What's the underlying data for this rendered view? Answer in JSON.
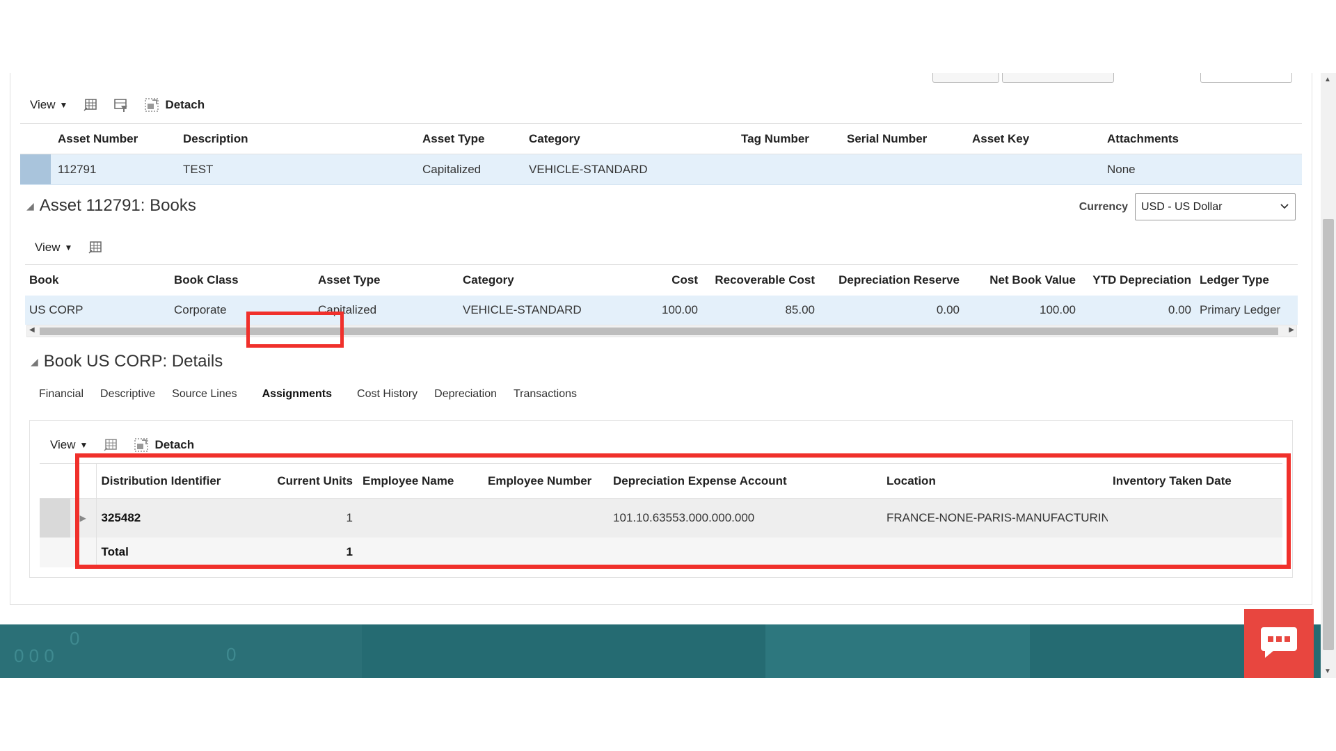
{
  "toolbar1": {
    "view_label": "View",
    "detach_label": "Detach"
  },
  "asset_table": {
    "headers": [
      "Asset Number",
      "Description",
      "Asset Type",
      "Category",
      "Tag Number",
      "Serial Number",
      "Asset Key",
      "Attachments"
    ],
    "row": {
      "asset_number": "112791",
      "description": "TEST",
      "asset_type": "Capitalized",
      "category": "VEHICLE-STANDARD",
      "tag_number": "",
      "serial_number": "",
      "asset_key": "",
      "attachments": "None"
    }
  },
  "books_section": {
    "title": "Asset 112791: Books",
    "currency_label": "Currency",
    "currency_value": "USD - US Dollar",
    "view_label": "View"
  },
  "books_table": {
    "headers": [
      "Book",
      "Book Class",
      "Asset Type",
      "Category",
      "Cost",
      "Recoverable Cost",
      "Depreciation Reserve",
      "Net Book Value",
      "YTD Depreciation",
      "Ledger Type"
    ],
    "row": {
      "book": "US CORP",
      "book_class": "Corporate",
      "asset_type": "Capitalized",
      "category": "VEHICLE-STANDARD",
      "cost": "100.00",
      "recoverable_cost": "85.00",
      "depreciation_reserve": "0.00",
      "net_book_value": "100.00",
      "ytd_depreciation": "0.00",
      "ledger_type": "Primary Ledger"
    }
  },
  "details_section": {
    "title": "Book US CORP: Details",
    "tabs": [
      "Financial",
      "Descriptive",
      "Source Lines",
      "Assignments",
      "Cost History",
      "Depreciation",
      "Transactions"
    ],
    "active_tab": "Assignments",
    "view_label": "View",
    "detach_label": "Detach"
  },
  "assignments_table": {
    "headers": [
      "Distribution Identifier",
      "Current Units",
      "Employee Name",
      "Employee Number",
      "Depreciation Expense Account",
      "Location",
      "Inventory Taken Date"
    ],
    "row": {
      "distribution_identifier": "325482",
      "current_units": "1",
      "employee_name": "",
      "employee_number": "",
      "depreciation_expense_account": "101.10.63553.000.000.000",
      "location": "FRANCE-NONE-PARIS-MANUFACTURIN(",
      "inventory_taken_date": ""
    },
    "total_label": "Total",
    "total_units": "1"
  },
  "colors": {
    "highlight": "#f0302b",
    "selected_row": "#e4f0fa",
    "footer": "#256b72",
    "chat_button": "#e8463f"
  },
  "icons": [
    "freeze-columns-icon",
    "query-by-example-icon",
    "detach-icon",
    "collapse-triangle-icon",
    "dropdown-chevron-icon",
    "expand-row-icon",
    "chat-icon"
  ]
}
